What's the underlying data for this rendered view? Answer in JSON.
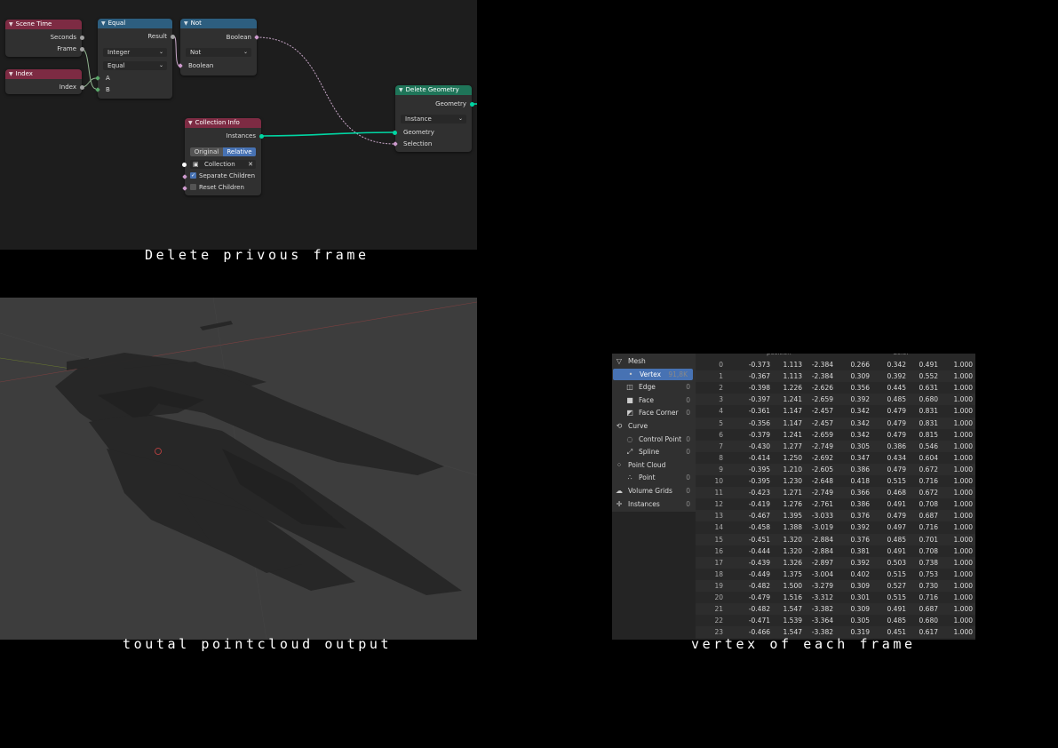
{
  "node_editor": {
    "scene_time": {
      "title": "Scene Time",
      "outputs": [
        "Seconds",
        "Frame"
      ]
    },
    "index_node": {
      "title": "Index",
      "output": "Index"
    },
    "equal_node": {
      "title": "Equal",
      "output": "Result",
      "data_type": "Integer",
      "operation": "Equal",
      "inputs": [
        "A",
        "B"
      ]
    },
    "not_node": {
      "title": "Not",
      "output": "Boolean",
      "operation": "Not",
      "input": "Boolean"
    },
    "collection_info": {
      "title": "Collection Info",
      "output": "Instances",
      "modes": [
        "Original",
        "Relative"
      ],
      "active_mode": "Relative",
      "collection_label": "Collection",
      "separate_children": "Separate Children",
      "reset_children": "Reset Children"
    },
    "delete_geometry": {
      "title": "Delete Geometry",
      "output": "Geometry",
      "domain": "Instance",
      "inputs": [
        "Geometry",
        "Selection"
      ]
    },
    "colors": {
      "input_header": "#7d2b43",
      "utility_header": "#2d5e7f",
      "geometry_header": "#1f7559",
      "geometry_socket": "#00d6a3"
    }
  },
  "captions": {
    "top": "Delete privous frame",
    "bottom_left": "toutal pointcloud output",
    "bottom_right": "vertex of each frame"
  },
  "spreadsheet": {
    "sidebar": [
      {
        "label": "Mesh",
        "count": "",
        "icon": "mesh-icon",
        "level": 0
      },
      {
        "label": "Vertex",
        "count": "91,8K",
        "icon": "vertex-icon",
        "level": 1,
        "selected": true
      },
      {
        "label": "Edge",
        "count": "0",
        "icon": "edge-icon",
        "level": 1
      },
      {
        "label": "Face",
        "count": "0",
        "icon": "face-icon",
        "level": 1
      },
      {
        "label": "Face Corner",
        "count": "0",
        "icon": "face-corner-icon",
        "level": 1
      },
      {
        "label": "Curve",
        "count": "",
        "icon": "curve-icon",
        "level": 0
      },
      {
        "label": "Control Point",
        "count": "0",
        "icon": "control-point-icon",
        "level": 1
      },
      {
        "label": "Spline",
        "count": "0",
        "icon": "spline-icon",
        "level": 1
      },
      {
        "label": "Point Cloud",
        "count": "",
        "icon": "point-cloud-icon",
        "level": 0
      },
      {
        "label": "Point",
        "count": "0",
        "icon": "point-icon",
        "level": 1
      },
      {
        "label": "Volume Grids",
        "count": "0",
        "icon": "volume-icon",
        "level": 0
      },
      {
        "label": "Instances",
        "count": "0",
        "icon": "instances-icon",
        "level": 0
      }
    ],
    "headers": [
      "position",
      "Color"
    ],
    "rows": [
      [
        "0",
        "-0.373",
        "1.113",
        "-2.384",
        "0.266",
        "0.342",
        "0.491",
        "1.000"
      ],
      [
        "1",
        "-0.367",
        "1.113",
        "-2.384",
        "0.309",
        "0.392",
        "0.552",
        "1.000"
      ],
      [
        "2",
        "-0.398",
        "1.226",
        "-2.626",
        "0.356",
        "0.445",
        "0.631",
        "1.000"
      ],
      [
        "3",
        "-0.397",
        "1.241",
        "-2.659",
        "0.392",
        "0.485",
        "0.680",
        "1.000"
      ],
      [
        "4",
        "-0.361",
        "1.147",
        "-2.457",
        "0.342",
        "0.479",
        "0.831",
        "1.000"
      ],
      [
        "5",
        "-0.356",
        "1.147",
        "-2.457",
        "0.342",
        "0.479",
        "0.831",
        "1.000"
      ],
      [
        "6",
        "-0.379",
        "1.241",
        "-2.659",
        "0.342",
        "0.479",
        "0.815",
        "1.000"
      ],
      [
        "7",
        "-0.430",
        "1.277",
        "-2.749",
        "0.305",
        "0.386",
        "0.546",
        "1.000"
      ],
      [
        "8",
        "-0.414",
        "1.250",
        "-2.692",
        "0.347",
        "0.434",
        "0.604",
        "1.000"
      ],
      [
        "9",
        "-0.395",
        "1.210",
        "-2.605",
        "0.386",
        "0.479",
        "0.672",
        "1.000"
      ],
      [
        "10",
        "-0.395",
        "1.230",
        "-2.648",
        "0.418",
        "0.515",
        "0.716",
        "1.000"
      ],
      [
        "11",
        "-0.423",
        "1.271",
        "-2.749",
        "0.366",
        "0.468",
        "0.672",
        "1.000"
      ],
      [
        "12",
        "-0.419",
        "1.276",
        "-2.761",
        "0.386",
        "0.491",
        "0.708",
        "1.000"
      ],
      [
        "13",
        "-0.467",
        "1.395",
        "-3.033",
        "0.376",
        "0.479",
        "0.687",
        "1.000"
      ],
      [
        "14",
        "-0.458",
        "1.388",
        "-3.019",
        "0.392",
        "0.497",
        "0.716",
        "1.000"
      ],
      [
        "15",
        "-0.451",
        "1.320",
        "-2.884",
        "0.376",
        "0.485",
        "0.701",
        "1.000"
      ],
      [
        "16",
        "-0.444",
        "1.320",
        "-2.884",
        "0.381",
        "0.491",
        "0.708",
        "1.000"
      ],
      [
        "17",
        "-0.439",
        "1.326",
        "-2.897",
        "0.392",
        "0.503",
        "0.738",
        "1.000"
      ],
      [
        "18",
        "-0.449",
        "1.375",
        "-3.004",
        "0.402",
        "0.515",
        "0.753",
        "1.000"
      ],
      [
        "19",
        "-0.482",
        "1.500",
        "-3.279",
        "0.309",
        "0.527",
        "0.730",
        "1.000"
      ],
      [
        "20",
        "-0.479",
        "1.516",
        "-3.312",
        "0.301",
        "0.515",
        "0.716",
        "1.000"
      ],
      [
        "21",
        "-0.482",
        "1.547",
        "-3.382",
        "0.309",
        "0.491",
        "0.687",
        "1.000"
      ],
      [
        "22",
        "-0.471",
        "1.539",
        "-3.364",
        "0.305",
        "0.485",
        "0.680",
        "1.000"
      ],
      [
        "23",
        "-0.466",
        "1.547",
        "-3.382",
        "0.319",
        "0.451",
        "0.617",
        "1.000"
      ]
    ]
  }
}
